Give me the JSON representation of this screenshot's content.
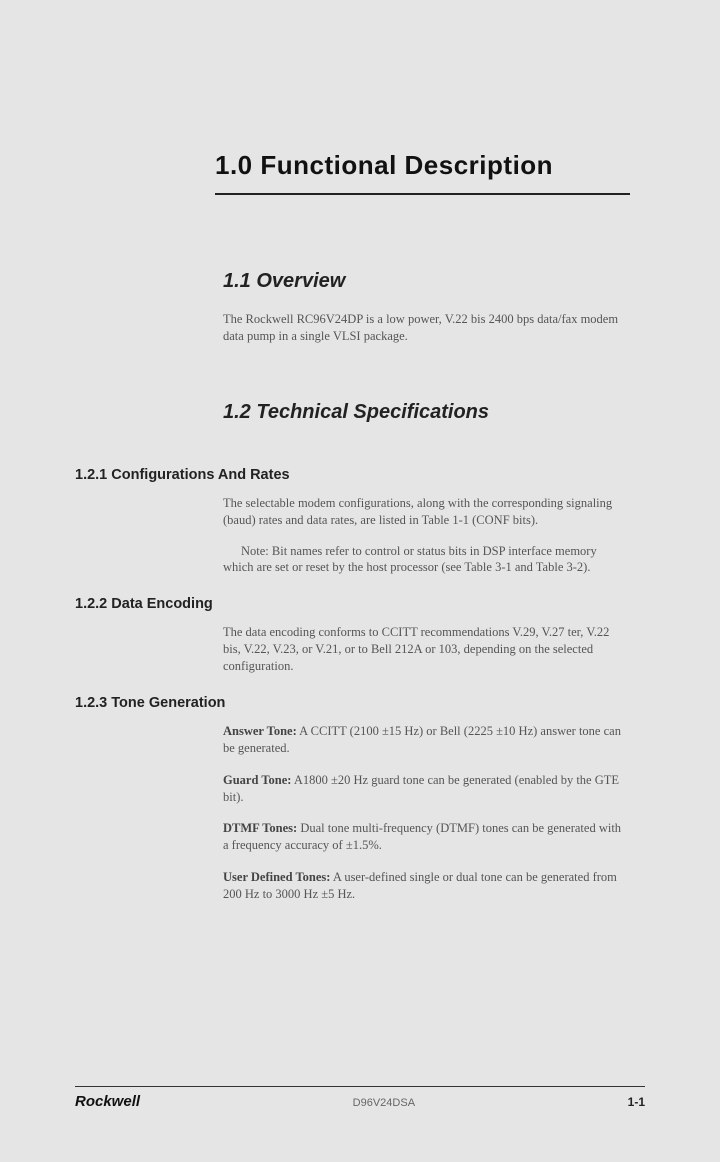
{
  "chapter": {
    "number_title": "1.0  Functional Description"
  },
  "sections": {
    "overview": {
      "heading": "1.1  Overview",
      "text": "The Rockwell RC96V24DP is a low power, V.22 bis 2400 bps data/fax modem data pump in a single VLSI package."
    },
    "techspec": {
      "heading": "1.2  Technical Specifications"
    },
    "configs": {
      "heading": "1.2.1  Configurations And Rates",
      "p1": "The selectable modem configurations, along with the corresponding signaling (baud) rates and data rates, are listed in Table 1-1 (CONF bits).",
      "p2": "Note: Bit names refer to control or status bits in DSP interface memory which are set or reset by the host processor (see Table 3-1 and Table 3-2)."
    },
    "encoding": {
      "heading": "1.2.2  Data Encoding",
      "p1": "The data encoding conforms to CCITT recommendations V.29, V.27 ter, V.22 bis, V.22, V.23, or V.21, or to Bell 212A or 103, depending on the selected configuration."
    },
    "tonegen": {
      "heading": "1.2.3  Tone Generation",
      "answer_lead": "Answer Tone:",
      "answer_text": " A CCITT (2100 ±15 Hz) or Bell (2225 ±10 Hz) answer tone can be generated.",
      "guard_lead": "Guard Tone:",
      "guard_text": " A1800 ±20 Hz guard tone can be generated (enabled by the GTE bit).",
      "dtmf_lead": "DTMF Tones:",
      "dtmf_text": " Dual tone multi-frequency (DTMF) tones can be generated with a frequency accuracy of ±1.5%.",
      "user_lead": "User Defined Tones:",
      "user_text": " A user-defined single or dual tone can be generated from 200 Hz to 3000 Hz ±5 Hz."
    }
  },
  "footer": {
    "brand": "Rockwell",
    "docid": "D96V24DSA",
    "pageno": "1-1"
  }
}
